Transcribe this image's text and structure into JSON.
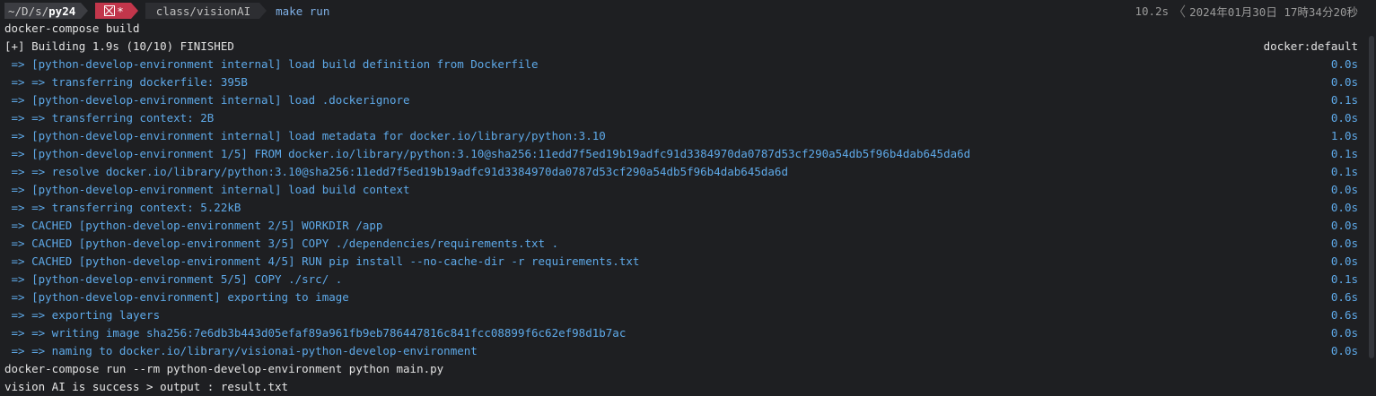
{
  "prompt": {
    "dir_prefix": "~/D/s/",
    "dir_bold": "py24",
    "git_status": "*",
    "path": "class/visionAI",
    "command": "make run",
    "duration": "10.2s",
    "datetime": "2024年01月30日 17時34分20秒"
  },
  "lines": [
    {
      "text": "docker-compose build",
      "right": "",
      "style": "plain"
    },
    {
      "text": "[+] Building 1.9s (10/10) FINISHED",
      "right": "docker:default",
      "style": "plain"
    },
    {
      "text": " => [python-develop-environment internal] load build definition from Dockerfile",
      "right": "0.0s",
      "style": "step"
    },
    {
      "text": " => => transferring dockerfile: 395B",
      "right": "0.0s",
      "style": "step"
    },
    {
      "text": " => [python-develop-environment internal] load .dockerignore",
      "right": "0.1s",
      "style": "step"
    },
    {
      "text": " => => transferring context: 2B",
      "right": "0.0s",
      "style": "step"
    },
    {
      "text": " => [python-develop-environment internal] load metadata for docker.io/library/python:3.10",
      "right": "1.0s",
      "style": "step"
    },
    {
      "text": " => [python-develop-environment 1/5] FROM docker.io/library/python:3.10@sha256:11edd7f5ed19b19adfc91d3384970da0787d53cf290a54db5f96b4dab645da6d",
      "right": "0.1s",
      "style": "step"
    },
    {
      "text": " => => resolve docker.io/library/python:3.10@sha256:11edd7f5ed19b19adfc91d3384970da0787d53cf290a54db5f96b4dab645da6d",
      "right": "0.1s",
      "style": "step"
    },
    {
      "text": " => [python-develop-environment internal] load build context",
      "right": "0.0s",
      "style": "step"
    },
    {
      "text": " => => transferring context: 5.22kB",
      "right": "0.0s",
      "style": "step"
    },
    {
      "text": " => CACHED [python-develop-environment 2/5] WORKDIR /app",
      "right": "0.0s",
      "style": "step"
    },
    {
      "text": " => CACHED [python-develop-environment 3/5] COPY ./dependencies/requirements.txt .",
      "right": "0.0s",
      "style": "step"
    },
    {
      "text": " => CACHED [python-develop-environment 4/5] RUN pip install --no-cache-dir -r requirements.txt",
      "right": "0.0s",
      "style": "step"
    },
    {
      "text": " => [python-develop-environment 5/5] COPY ./src/ .",
      "right": "0.1s",
      "style": "step"
    },
    {
      "text": " => [python-develop-environment] exporting to image",
      "right": "0.6s",
      "style": "step"
    },
    {
      "text": " => => exporting layers",
      "right": "0.6s",
      "style": "step"
    },
    {
      "text": " => => writing image sha256:7e6db3b443d05efaf89a961fb9eb786447816c841fcc08899f6c62ef98d1b7ac",
      "right": "0.0s",
      "style": "step"
    },
    {
      "text": " => => naming to docker.io/library/visionai-python-develop-environment",
      "right": "0.0s",
      "style": "step"
    },
    {
      "text": "docker-compose run --rm python-develop-environment python main.py",
      "right": "",
      "style": "plain"
    },
    {
      "text": "vision AI is success > output : result.txt",
      "right": "",
      "style": "output"
    }
  ]
}
